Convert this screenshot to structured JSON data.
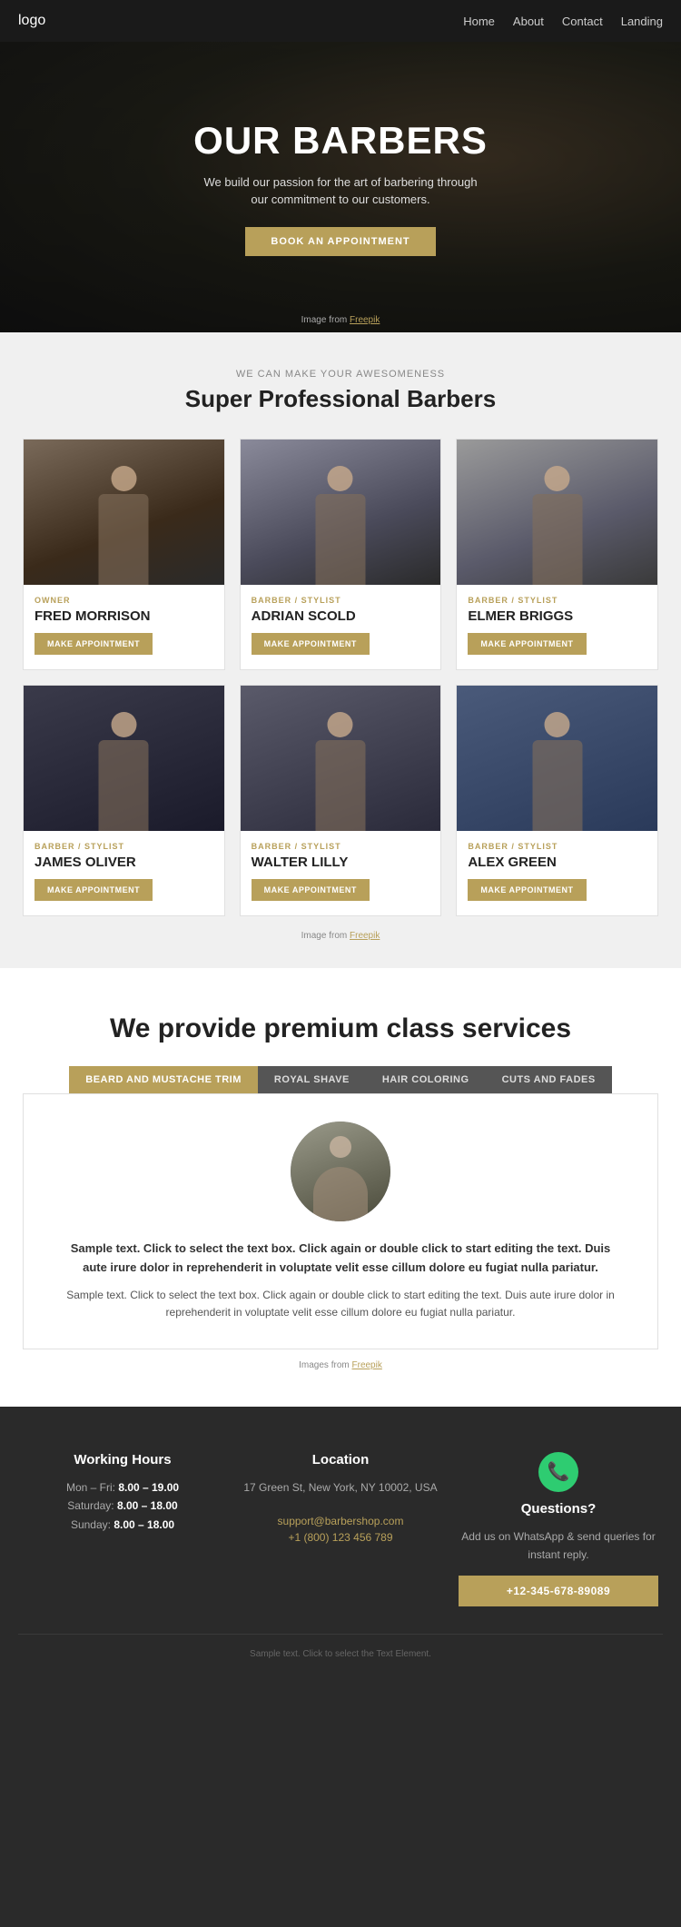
{
  "nav": {
    "logo": "logo",
    "links": [
      {
        "label": "Home",
        "href": "#"
      },
      {
        "label": "About",
        "href": "#"
      },
      {
        "label": "Contact",
        "href": "#"
      },
      {
        "label": "Landing",
        "href": "#"
      }
    ]
  },
  "hero": {
    "title": "OUR BARBERS",
    "subtitle": "We build our passion for the art of barbering through our commitment to our customers.",
    "cta_label": "BOOK AN APPOINTMENT",
    "credit_text": "Image from ",
    "credit_link": "Freepik"
  },
  "barbers_section": {
    "subtitle": "WE CAN MAKE YOUR AWESOMENESS",
    "title": "Super Professional Barbers",
    "credit_text": "Image from ",
    "credit_link": "Freepik",
    "barbers": [
      {
        "role": "OWNER",
        "name": "FRED MORRISON",
        "btn": "MAKE APPOINTMENT",
        "photo_class": "photo-1"
      },
      {
        "role": "BARBER / STYLIST",
        "name": "ADRIAN SCOLD",
        "btn": "MAKE APPOINTMENT",
        "photo_class": "photo-2"
      },
      {
        "role": "BARBER / STYLIST",
        "name": "ELMER BRIGGS",
        "btn": "MAKE APPOINTMENT",
        "photo_class": "photo-3"
      },
      {
        "role": "BARBER / STYLIST",
        "name": "JAMES OLIVER",
        "btn": "MAKE APPOINTMENT",
        "photo_class": "photo-4"
      },
      {
        "role": "BARBER / STYLIST",
        "name": "WALTER LILLY",
        "btn": "MAKE APPOINTMENT",
        "photo_class": "photo-5"
      },
      {
        "role": "BARBER / STYLIST",
        "name": "ALEX GREEN",
        "btn": "MAKE APPOINTMENT",
        "photo_class": "photo-6"
      }
    ]
  },
  "services_section": {
    "title": "We provide premium class services",
    "tabs": [
      {
        "label": "BEARD AND MUSTACHE TRIM",
        "active": true
      },
      {
        "label": "ROYAL SHAVE",
        "active": false
      },
      {
        "label": "HAIR COLORING",
        "active": false
      },
      {
        "label": "CUTS AND FADES",
        "active": false
      }
    ],
    "service_text_bold": "Sample text. Click to select the text box. Click again or double click to start editing the text. Duis aute irure dolor in reprehenderit in voluptate velit esse cillum dolore eu fugiat nulla pariatur.",
    "service_text": "Sample text. Click to select the text box. Click again or double click to start editing the text. Duis aute irure dolor in reprehenderit in voluptate velit esse cillum dolore eu fugiat nulla pariatur.",
    "credit_text": "Images from ",
    "credit_link": "Freepik"
  },
  "footer": {
    "working_hours": {
      "title": "Working Hours",
      "hours": [
        {
          "days": "Mon – Fri:",
          "time": "8.00 – 19.00"
        },
        {
          "days": "Saturday:",
          "time": "8.00 – 18.00"
        },
        {
          "days": "Sunday:",
          "time": "8.00 – 18.00"
        }
      ]
    },
    "location": {
      "title": "Location",
      "address": "17 Green St, New York, NY 10002, USA",
      "email": "support@barbershop.com",
      "phone": "+1 (800) 123 456 789"
    },
    "contact": {
      "title": "Questions?",
      "text": "Add us on WhatsApp & send queries for instant reply.",
      "btn_label": "+12-345-678-89089"
    },
    "bottom_text": "Sample text. Click to select the Text Element."
  }
}
